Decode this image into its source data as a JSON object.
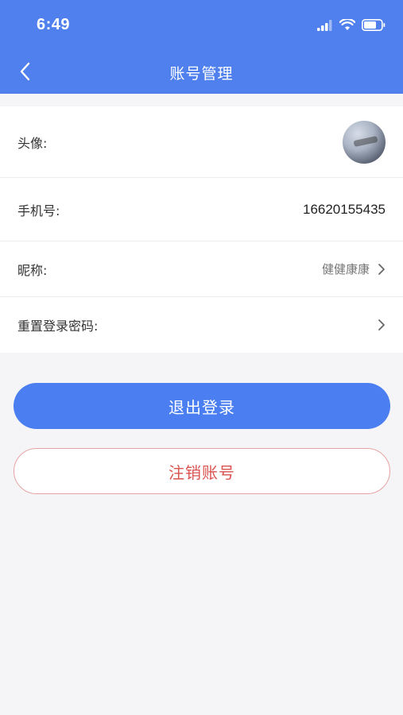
{
  "status_bar": {
    "time": "6:49",
    "icons": [
      "cellular-signal-icon",
      "wifi-icon",
      "battery-icon"
    ]
  },
  "nav": {
    "back_icon": "chevron-left-icon",
    "title": "账号管理"
  },
  "rows": {
    "avatar": {
      "label": "头像:"
    },
    "phone": {
      "label": "手机号:",
      "value": "16620155435"
    },
    "nickname": {
      "label": "昵称:",
      "value": "健健康康"
    },
    "reset_password": {
      "label": "重置登录密码:"
    }
  },
  "buttons": {
    "logout": "退出登录",
    "deactivate": "注销账号"
  },
  "colors": {
    "primary": "#4a7ef1",
    "danger": "#d9534f",
    "background": "#f5f5f7"
  }
}
